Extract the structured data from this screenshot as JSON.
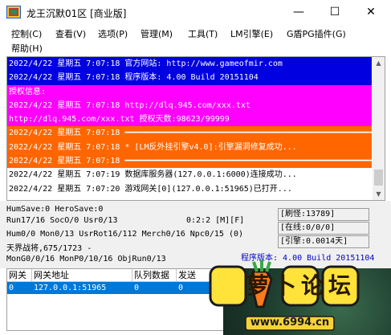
{
  "window": {
    "title": "龙王沉默01区 [商业版]",
    "controls": [
      "—",
      "☐",
      "✕"
    ]
  },
  "menu": [
    "控制(C)",
    "查看(V)",
    "选项(P)",
    "管理(M)",
    "工具(T)",
    "LM引擎(E)",
    "G盾PG插件(G)",
    "帮助(H)"
  ],
  "log": {
    "lines": [
      {
        "text": "2022/4/22 星期五 7:07:18 官方网站: http://www.gameofmir.com",
        "bg": "#0000e0",
        "fg": "#ffffff"
      },
      {
        "text": "2022/4/22 星期五 7:07:18 程序版本: 4.00 Build 20151104",
        "bg": "#0000e0",
        "fg": "#ffffff"
      },
      {
        "text": "授权信息:",
        "bg": "#ff00ff",
        "fg": "#ffffff"
      },
      {
        "text": "2022/4/22 星期五 7:07:18 http://dlq.945.com/xxx.txt",
        "bg": "#ff00ff",
        "fg": "#ffffff"
      },
      {
        "text": "http://dlq.945.com/xxx.txt 授权天数:98623/99999",
        "bg": "#ff00ff",
        "fg": "#ffffff"
      },
      {
        "text": "2022/4/22 星期五 7:07:18 ━━━━━━━━━━━━━━━━━━━━━━━━━━━━━━━━━━━━━━━━━━━━━━━━━━━━━━━━━━━",
        "bg": "#ff6600",
        "fg": "#ffffff"
      },
      {
        "text": "2022/4/22 星期五 7:07:18 * [LM反外挂引擎v4.0]:引擎漏洞修复成功...",
        "bg": "#ff6600",
        "fg": "#ffffff"
      },
      {
        "text": "2022/4/22 星期五 7:07:18 ━━━━━━━━━━━━━━━━━━━━━━━━━━━━━━━━━━━━━━━━━━━━━━━━━━━━━━━━━━━",
        "bg": "#ff6600",
        "fg": "#ffffff"
      },
      {
        "text": "2022/4/22 星期五 7:07:19 数据库服务器(127.0.0.1:6000)连接成功...",
        "bg": "#ffffff",
        "fg": "#000000"
      },
      {
        "text": "2022/4/22 星期五 7:07:20 游戏网关[0](127.0.0.1:51965)已打开...",
        "bg": "#ffffff",
        "fg": "#000000"
      }
    ]
  },
  "status": {
    "line1": "HumSave:0 HeroSave:0",
    "line2": "Run17/16 SocO/0 Usr0/13",
    "line2b": "0:2:2 [M][F]",
    "line3": "Hum0/0 Mon0/13 UsrRot16/112 Merch0/16 Npc0/15 (0)",
    "line4": "天界战将,675/1723 -",
    "line5": "MonG0/0/16 MonP0/10/16 ObjRun0/13",
    "counter1": "[刷怪:13789]",
    "counter2": "[在线:0/0/0]",
    "counter3": "[引擎:0.0014天]",
    "version": "程序版本: 4.00 Build 20151104"
  },
  "grid": {
    "headers": [
      "网关",
      "网关地址",
      "队列数据",
      "发送"
    ],
    "rows": [
      [
        "0",
        "127.0.0.1:51965",
        "0",
        "0"
      ]
    ]
  },
  "watermark": {
    "text": "萝卜论坛",
    "url": "www.6994.cn"
  }
}
